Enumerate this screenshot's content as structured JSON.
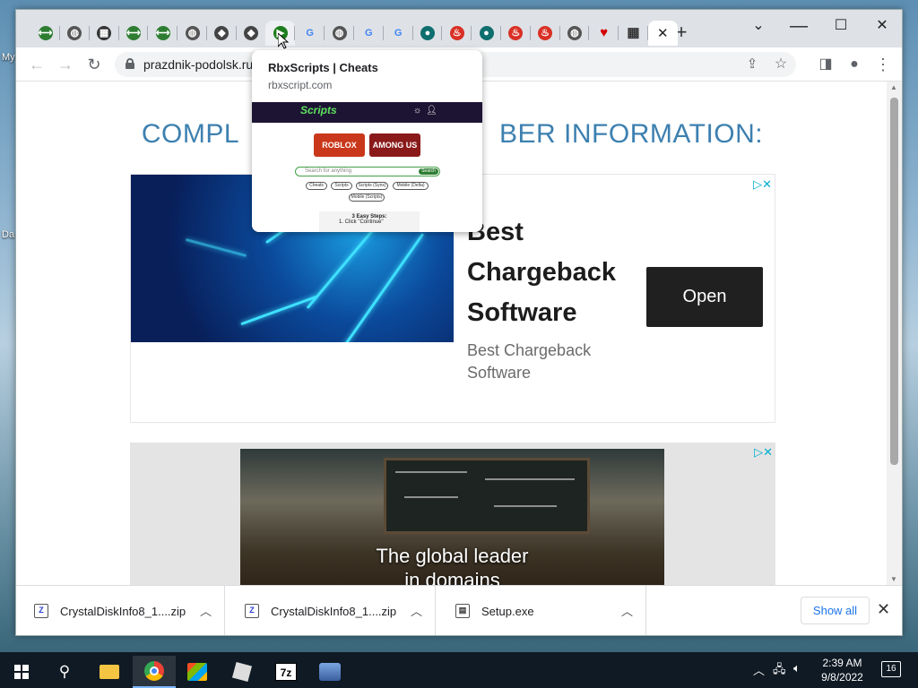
{
  "desktop": {
    "label_top": "My",
    "label_bottom": "Da"
  },
  "browser": {
    "tabs": [
      {
        "icon": "link-green-icon",
        "color": "#2e7d32"
      },
      {
        "icon": "globe-icon",
        "color": "#555555"
      },
      {
        "icon": "film-icon",
        "color": "#333333"
      },
      {
        "icon": "link-green-icon",
        "color": "#2e7d32"
      },
      {
        "icon": "link-green-icon",
        "color": "#2e7d32"
      },
      {
        "icon": "globe-icon",
        "color": "#555555"
      },
      {
        "icon": "roblox-icon",
        "color": "#444444"
      },
      {
        "icon": "roblox-icon",
        "color": "#444444"
      },
      {
        "icon": "rbxscripts-icon",
        "color": "#1e7d1e"
      },
      {
        "icon": "google-icon",
        "color": "#4285f4"
      },
      {
        "icon": "globe-icon",
        "color": "#555555"
      },
      {
        "icon": "google-icon",
        "color": "#4285f4"
      },
      {
        "icon": "google-icon",
        "color": "#4285f4"
      },
      {
        "icon": "teal-circle-icon",
        "color": "#0f6e6e"
      },
      {
        "icon": "fire-red-icon",
        "color": "#d93025"
      },
      {
        "icon": "teal-circle-icon",
        "color": "#0f6e6e"
      },
      {
        "icon": "fire-red-icon",
        "color": "#d93025"
      },
      {
        "icon": "fire-red-icon",
        "color": "#d93025"
      },
      {
        "icon": "globe-icon",
        "color": "#555555"
      },
      {
        "icon": "heart-icon",
        "color": "#d50000"
      },
      {
        "icon": "table-grid-icon",
        "color": "#333333"
      }
    ],
    "url": "prazdnik-podolsk.ru",
    "hover_card": {
      "title": "RbxScripts | Cheats",
      "domain": "rbxscript.com",
      "logo": "Scripts",
      "games": [
        "ROBLOX",
        "AMONG US"
      ],
      "search_placeholder": "Search for anything",
      "search_button": "Search",
      "chips": [
        "Cheats",
        "Scripts",
        "Scripts (Synx)",
        "Mobile (Delta)",
        "Mobile (Scripts)"
      ],
      "steps_title": "3 Easy Steps:",
      "steps_first": "1. Click \"Continue\""
    }
  },
  "page": {
    "heading_left": "COMPL",
    "heading_right": "BER INFORMATION:",
    "ad1": {
      "title": "Best Chargeback Software",
      "subtitle": "Best Chargeback Software",
      "button": "Open",
      "choices": "▷✕"
    },
    "ad2": {
      "text_line1": "The global leader",
      "text_line2": "in domains",
      "choices": "▷✕"
    }
  },
  "downloads": {
    "items": [
      {
        "name": "CrystalDiskInfo8_1....zip",
        "icon": "zip-file-icon"
      },
      {
        "name": "CrystalDiskInfo8_1....zip",
        "icon": "zip-file-icon"
      },
      {
        "name": "Setup.exe",
        "icon": "exe-file-icon"
      }
    ],
    "show_all": "Show all"
  },
  "taskbar": {
    "time": "2:39 AM",
    "date": "9/8/2022",
    "notifications": "16"
  }
}
